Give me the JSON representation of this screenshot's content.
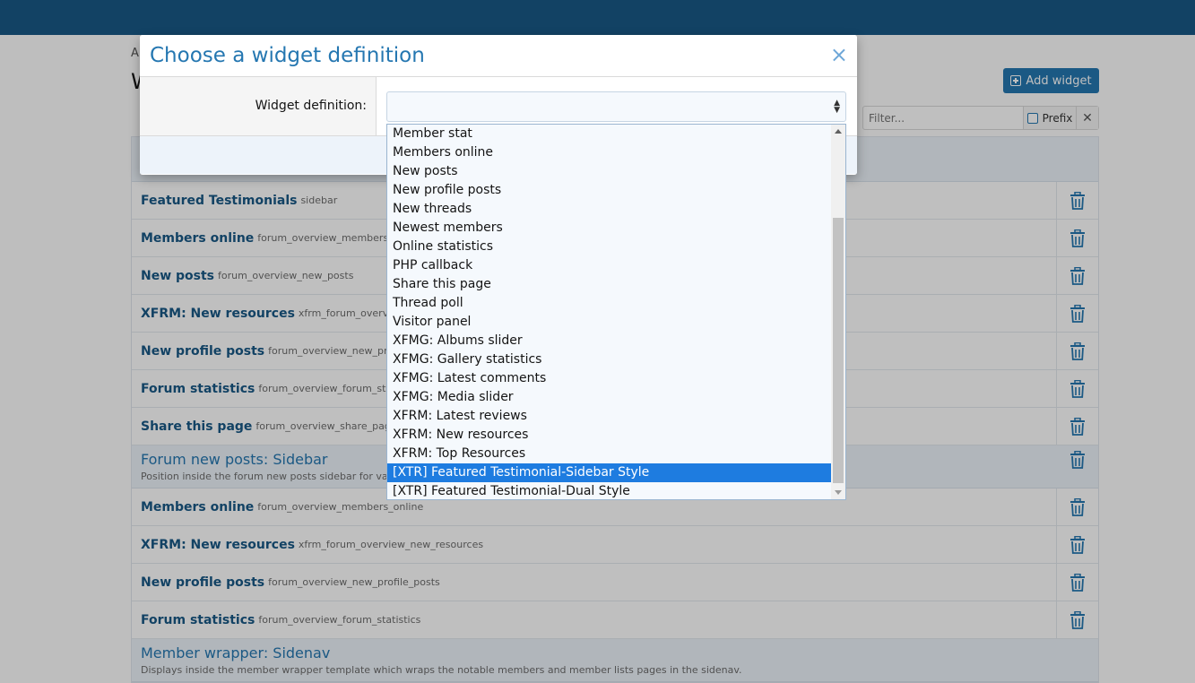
{
  "page": {
    "crumb": "A",
    "title": "W",
    "add_button_label": "Add widget",
    "filter_placeholder": "Filter...",
    "prefix_label": "Prefix",
    "clear_label": "✕"
  },
  "groups": [
    {
      "title": "",
      "description": "",
      "rows": [
        {
          "title": "Featured Testimonials",
          "key": "sidebar"
        },
        {
          "title": "Members online",
          "key": "forum_overview_members_online"
        },
        {
          "title": "New posts",
          "key": "forum_overview_new_posts"
        },
        {
          "title": "XFRM: New resources",
          "key": "xfrm_forum_overview_new_resources"
        },
        {
          "title": "New profile posts",
          "key": "forum_overview_new_profile_posts"
        },
        {
          "title": "Forum statistics",
          "key": "forum_overview_forum_statistics"
        },
        {
          "title": "Share this page",
          "key": "forum_overview_share_page"
        }
      ]
    },
    {
      "title": "Forum new posts: Sidebar",
      "description": "Position inside the forum new posts sidebar for various widgets. Only applicable when the forum index page is set to \"New posts\".",
      "rows": [
        {
          "title": "Members online",
          "key": "forum_overview_members_online"
        },
        {
          "title": "XFRM: New resources",
          "key": "xfrm_forum_overview_new_resources"
        },
        {
          "title": "New profile posts",
          "key": "forum_overview_new_profile_posts"
        },
        {
          "title": "Forum statistics",
          "key": "forum_overview_forum_statistics"
        }
      ]
    },
    {
      "title": "Member wrapper: Sidenav",
      "description": "Displays inside the member wrapper template which wraps the notable members and member lists pages in the sidenav.",
      "rows": []
    }
  ],
  "modal": {
    "title": "Choose a widget definition",
    "close_label": "×",
    "field_label": "Widget definition:",
    "select_value": ""
  },
  "dropdown": {
    "options": [
      "Member stat",
      "Members online",
      "New posts",
      "New profile posts",
      "New threads",
      "Newest members",
      "Online statistics",
      "PHP callback",
      "Share this page",
      "Thread poll",
      "Visitor panel",
      "XFMG: Albums slider",
      "XFMG: Gallery statistics",
      "XFMG: Latest comments",
      "XFMG: Media slider",
      "XFRM: Latest reviews",
      "XFRM: New resources",
      "XFRM: Top Resources",
      "[XTR] Featured Testimonial-Sidebar Style",
      "[XTR] Featured Testimonial-Dual Style"
    ],
    "selected": "[XTR] Featured Testimonial-Sidebar Style"
  },
  "colors": {
    "topbar": "#185886",
    "accent": "#2577b1",
    "selected_option": "#1e7ce0"
  }
}
